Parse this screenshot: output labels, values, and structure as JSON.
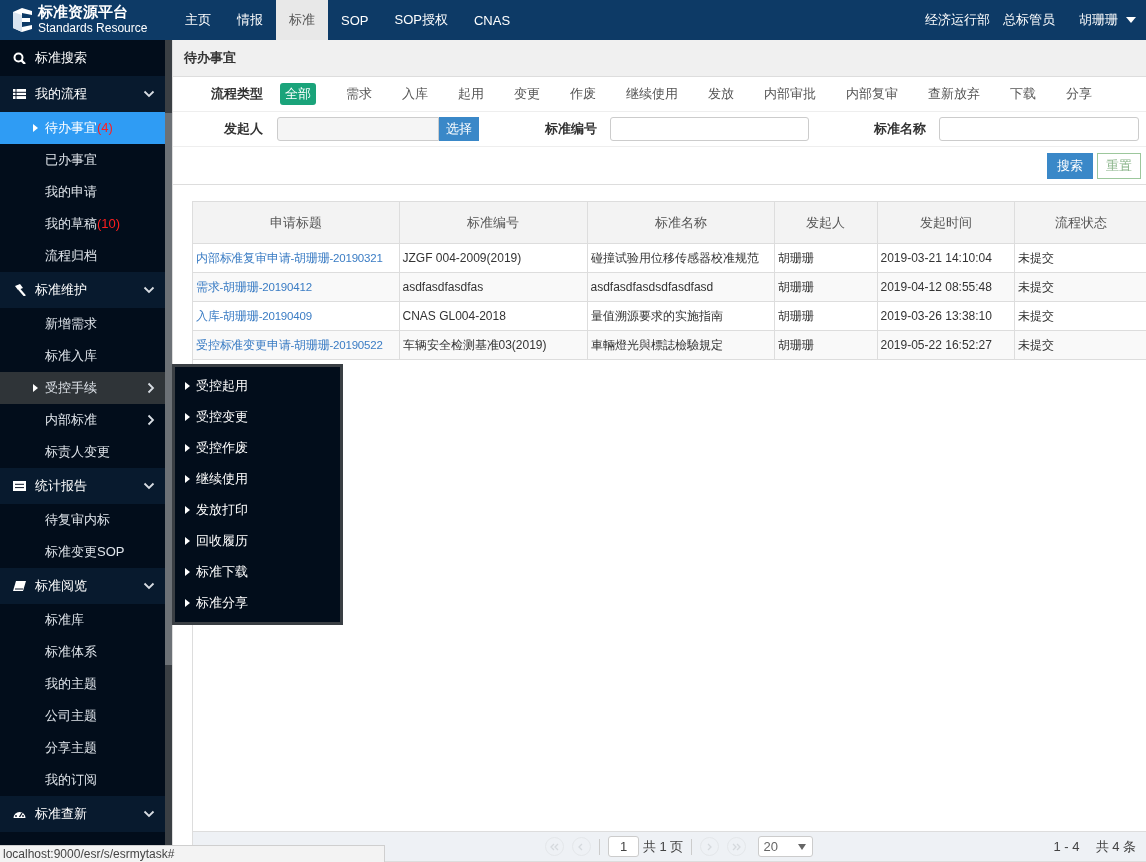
{
  "header": {
    "logo_title": "标准资源平台",
    "logo_subtitle": "Standards Resource",
    "nav": [
      {
        "label": "主页",
        "selected": false
      },
      {
        "label": "情报",
        "selected": false
      },
      {
        "label": "标准",
        "selected": true
      },
      {
        "label": "SOP",
        "selected": false
      },
      {
        "label": "SOP授权",
        "selected": false
      },
      {
        "label": "CNAS",
        "selected": false
      }
    ],
    "department": "经济运行部",
    "role": "总标管员",
    "user": "胡珊珊"
  },
  "sidebar": {
    "items": [
      {
        "kind": "link",
        "label": "标准搜索"
      },
      {
        "kind": "group",
        "label": "我的流程",
        "expanded": true,
        "children": [
          {
            "label": "待办事宜",
            "count": "(4)",
            "selected": true,
            "has_submenu": false,
            "open": false
          },
          {
            "label": "已办事宜",
            "selected": false,
            "has_submenu": false,
            "open": false
          },
          {
            "label": "我的申请",
            "selected": false,
            "has_submenu": false,
            "open": false
          },
          {
            "label": "我的草稿",
            "count": "(10)",
            "selected": false,
            "has_submenu": false,
            "open": false
          },
          {
            "label": "流程归档",
            "selected": false,
            "has_submenu": false,
            "open": false
          }
        ]
      },
      {
        "kind": "group",
        "label": "标准维护",
        "expanded": true,
        "children": [
          {
            "label": "新增需求",
            "selected": false,
            "has_submenu": false,
            "open": false
          },
          {
            "label": "标准入库",
            "selected": false,
            "has_submenu": false,
            "open": false
          },
          {
            "label": "受控手续",
            "selected": false,
            "has_submenu": true,
            "open": true
          },
          {
            "label": "内部标准",
            "selected": false,
            "has_submenu": true,
            "open": false
          },
          {
            "label": "标责人变更",
            "selected": false,
            "has_submenu": false,
            "open": false
          }
        ]
      },
      {
        "kind": "group",
        "label": "统计报告",
        "expanded": true,
        "children": [
          {
            "label": "待复审内标",
            "selected": false,
            "has_submenu": false,
            "open": false
          },
          {
            "label": "标准变更SOP",
            "selected": false,
            "has_submenu": false,
            "open": false
          }
        ]
      },
      {
        "kind": "group",
        "label": "标准阅览",
        "expanded": true,
        "children": [
          {
            "label": "标准库",
            "selected": false,
            "has_submenu": false,
            "open": false
          },
          {
            "label": "标准体系",
            "selected": false,
            "has_submenu": false,
            "open": false
          },
          {
            "label": "我的主题",
            "selected": false,
            "has_submenu": false,
            "open": false
          },
          {
            "label": "公司主题",
            "selected": false,
            "has_submenu": false,
            "open": false
          },
          {
            "label": "分享主题",
            "selected": false,
            "has_submenu": false,
            "open": false
          },
          {
            "label": "我的订阅",
            "selected": false,
            "has_submenu": false,
            "open": false
          }
        ]
      },
      {
        "kind": "group",
        "label": "标准查新",
        "expanded": true
      }
    ]
  },
  "flyout_menu": {
    "items": [
      "受控起用",
      "受控变更",
      "受控作废",
      "继续使用",
      "发放打印",
      "回收履历",
      "标准下载",
      "标准分享"
    ]
  },
  "panel": {
    "title": "待办事宜",
    "filters": {
      "type_label": "流程类型",
      "types": [
        {
          "label": "全部",
          "selected": true
        },
        {
          "label": "需求",
          "selected": false
        },
        {
          "label": "入库",
          "selected": false
        },
        {
          "label": "起用",
          "selected": false
        },
        {
          "label": "变更",
          "selected": false
        },
        {
          "label": "作废",
          "selected": false
        },
        {
          "label": "继续使用",
          "selected": false
        },
        {
          "label": "发放",
          "selected": false
        },
        {
          "label": "内部审批",
          "selected": false
        },
        {
          "label": "内部复审",
          "selected": false
        },
        {
          "label": "查新放弃",
          "selected": false
        },
        {
          "label": "下载",
          "selected": false
        },
        {
          "label": "分享",
          "selected": false
        }
      ],
      "initiator_label": "发起人",
      "select_button": "选择",
      "number_label": "标准编号",
      "name_label": "标准名称"
    },
    "search_button": "搜索",
    "reset_button": "重置",
    "table": {
      "columns": [
        "申请标题",
        "标准编号",
        "标准名称",
        "发起人",
        "发起时间",
        "流程状态"
      ],
      "rows": [
        [
          "内部标准复审申请-胡珊珊-20190321",
          "JZGF 004-2009(2019)",
          "碰撞试验用位移传感器校准规范",
          "胡珊珊",
          "2019-03-21 14:10:04",
          "未提交"
        ],
        [
          "需求-胡珊珊-20190412",
          "asdfasdfasdfas",
          "asdfasdfasdsdfasdfasd",
          "胡珊珊",
          "2019-04-12 08:55:48",
          "未提交"
        ],
        [
          "入库-胡珊珊-20190409",
          "CNAS GL004-2018",
          "量值溯源要求的实施指南",
          "胡珊珊",
          "2019-03-26 13:38:10",
          "未提交"
        ],
        [
          "受控标准变更申请-胡珊珊-20190522",
          "车辆安全检测基准03(2019)",
          "車輛燈光與標誌檢驗規定",
          "胡珊珊",
          "2019-05-22 16:52:27",
          "未提交"
        ]
      ]
    },
    "pagination": {
      "page": "1",
      "pages": "共 1 页",
      "page_size": "20",
      "range": "1 - 4",
      "total": "共 4 条"
    }
  },
  "status_url": "localhost:9000/esr/s/esrmytask#"
}
